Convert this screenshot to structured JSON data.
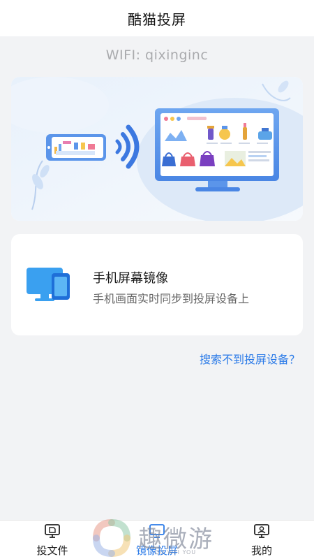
{
  "header": {
    "title": "酷猫投屏"
  },
  "wifi": {
    "label": "WIFI: qixinginc"
  },
  "hero": {
    "illustration": "phone-to-tv-cast"
  },
  "mirror_card": {
    "title": "手机屏幕镜像",
    "subtitle": "手机画面实时同步到投屏设备上",
    "icon": "screen-mirror-icon"
  },
  "help": {
    "link": "搜索不到投屏设备？"
  },
  "tabbar": {
    "tabs": [
      {
        "label": "投文件",
        "icon": "cast-file-icon",
        "active": false
      },
      {
        "label": "镜像投屏",
        "icon": "mirror-cast-icon",
        "active": true
      },
      {
        "label": "我的",
        "icon": "profile-icon",
        "active": false
      }
    ]
  },
  "watermark": {
    "text": "趣微游",
    "sub": "QU WEI YOU"
  },
  "colors": {
    "accent": "#2a7ae8",
    "background": "#f2f3f5",
    "card": "#ffffff"
  }
}
